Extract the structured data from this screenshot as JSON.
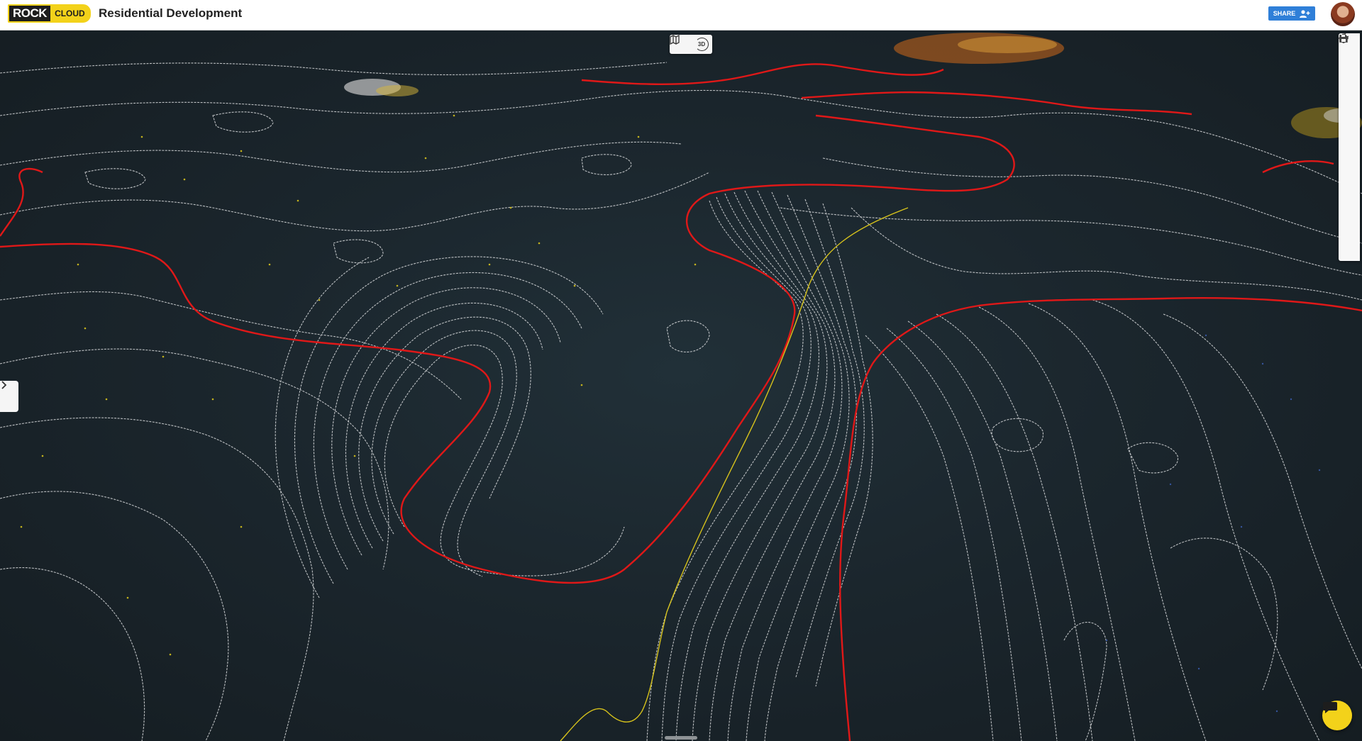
{
  "header": {
    "logo_rock": "ROCK",
    "logo_cloud": "CLOUD",
    "project_title": "Residential Development",
    "share_label": "SHARE"
  },
  "view_toggle": {
    "map_icon": "map-icon",
    "label_3d": "3D"
  },
  "toolbar": {
    "tools": [
      "pencil-icon",
      "volume-icon",
      "angle-measure-icon",
      "move-icon",
      "pin-icon",
      "layers-icon",
      "flag-icon",
      "eye-icon",
      "wrench-icon",
      "link-icon",
      "save-icon"
    ]
  },
  "colors": {
    "accent_yellow": "#f3d21a",
    "share_blue": "#2f7fd8",
    "contour_minor": "#d8dadc",
    "contour_major": "#e01818",
    "contour_highlight": "#d6c21c",
    "background": "#1a232a"
  },
  "icons": {
    "sidebar_toggle": "chevron-right-icon",
    "chat": "chat-icon",
    "share_user": "add-user-icon"
  }
}
